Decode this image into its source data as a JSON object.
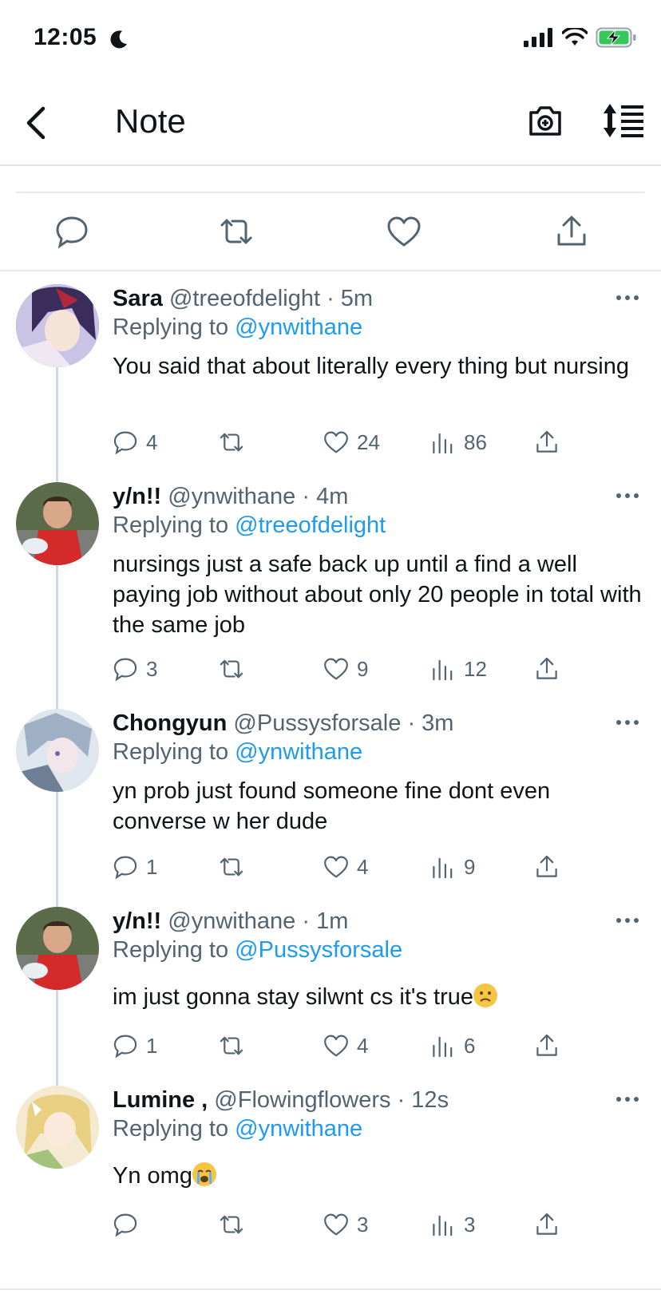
{
  "status_bar": {
    "time": "12:05"
  },
  "header": {
    "title": "Note"
  },
  "replies": [
    {
      "name": "Sara",
      "handle": "@treeofdelight",
      "time": "· 5m",
      "replying_prefix": "Replying to",
      "replying_to": "@ynwithane",
      "text": "You said that about literally every thing but nursing",
      "emoji": "",
      "replies_count": "4",
      "likes": "24",
      "views": "86",
      "avatar_color": "#6b5fa8"
    },
    {
      "name": "y/n!!",
      "handle": "@ynwithane",
      "time": "· 4m",
      "replying_prefix": "Replying to",
      "replying_to": "@treeofdelight",
      "text": "nursings just a safe back up until a find a well paying job without about only 20 people in total with the same job",
      "emoji": "",
      "replies_count": "3",
      "likes": "9",
      "views": "12",
      "avatar_color": "#4f5b3c"
    },
    {
      "name": "Chongyun",
      "handle": "@Pussysforsale",
      "time": "· 3m",
      "replying_prefix": "Replying to",
      "replying_to": "@ynwithane",
      "text": "yn prob just found someone fine dont even converse w her dude",
      "emoji": "",
      "replies_count": "1",
      "likes": "4",
      "views": "9",
      "avatar_color": "#aebccc"
    },
    {
      "name": "y/n!!",
      "handle": "@ynwithane",
      "time": "· 1m",
      "replying_prefix": "Replying to",
      "replying_to": "@Pussysforsale",
      "text": "im just gonna stay silwnt cs it's true",
      "emoji": "frowning-face",
      "replies_count": "1",
      "likes": "4",
      "views": "6",
      "avatar_color": "#4f5b3c"
    },
    {
      "name": "Lumine ,",
      "handle": "@Flowingflowers",
      "time": "· 12s",
      "replying_prefix": "Replying to",
      "replying_to": "@ynwithane",
      "text": "Yn omg",
      "emoji": "crying-face",
      "replies_count": "",
      "likes": "3",
      "views": "3",
      "avatar_color": "#e8d79a"
    }
  ],
  "colors": {
    "accent": "#1d9bf0",
    "secondary_text": "#536471",
    "icon": "#536471"
  }
}
